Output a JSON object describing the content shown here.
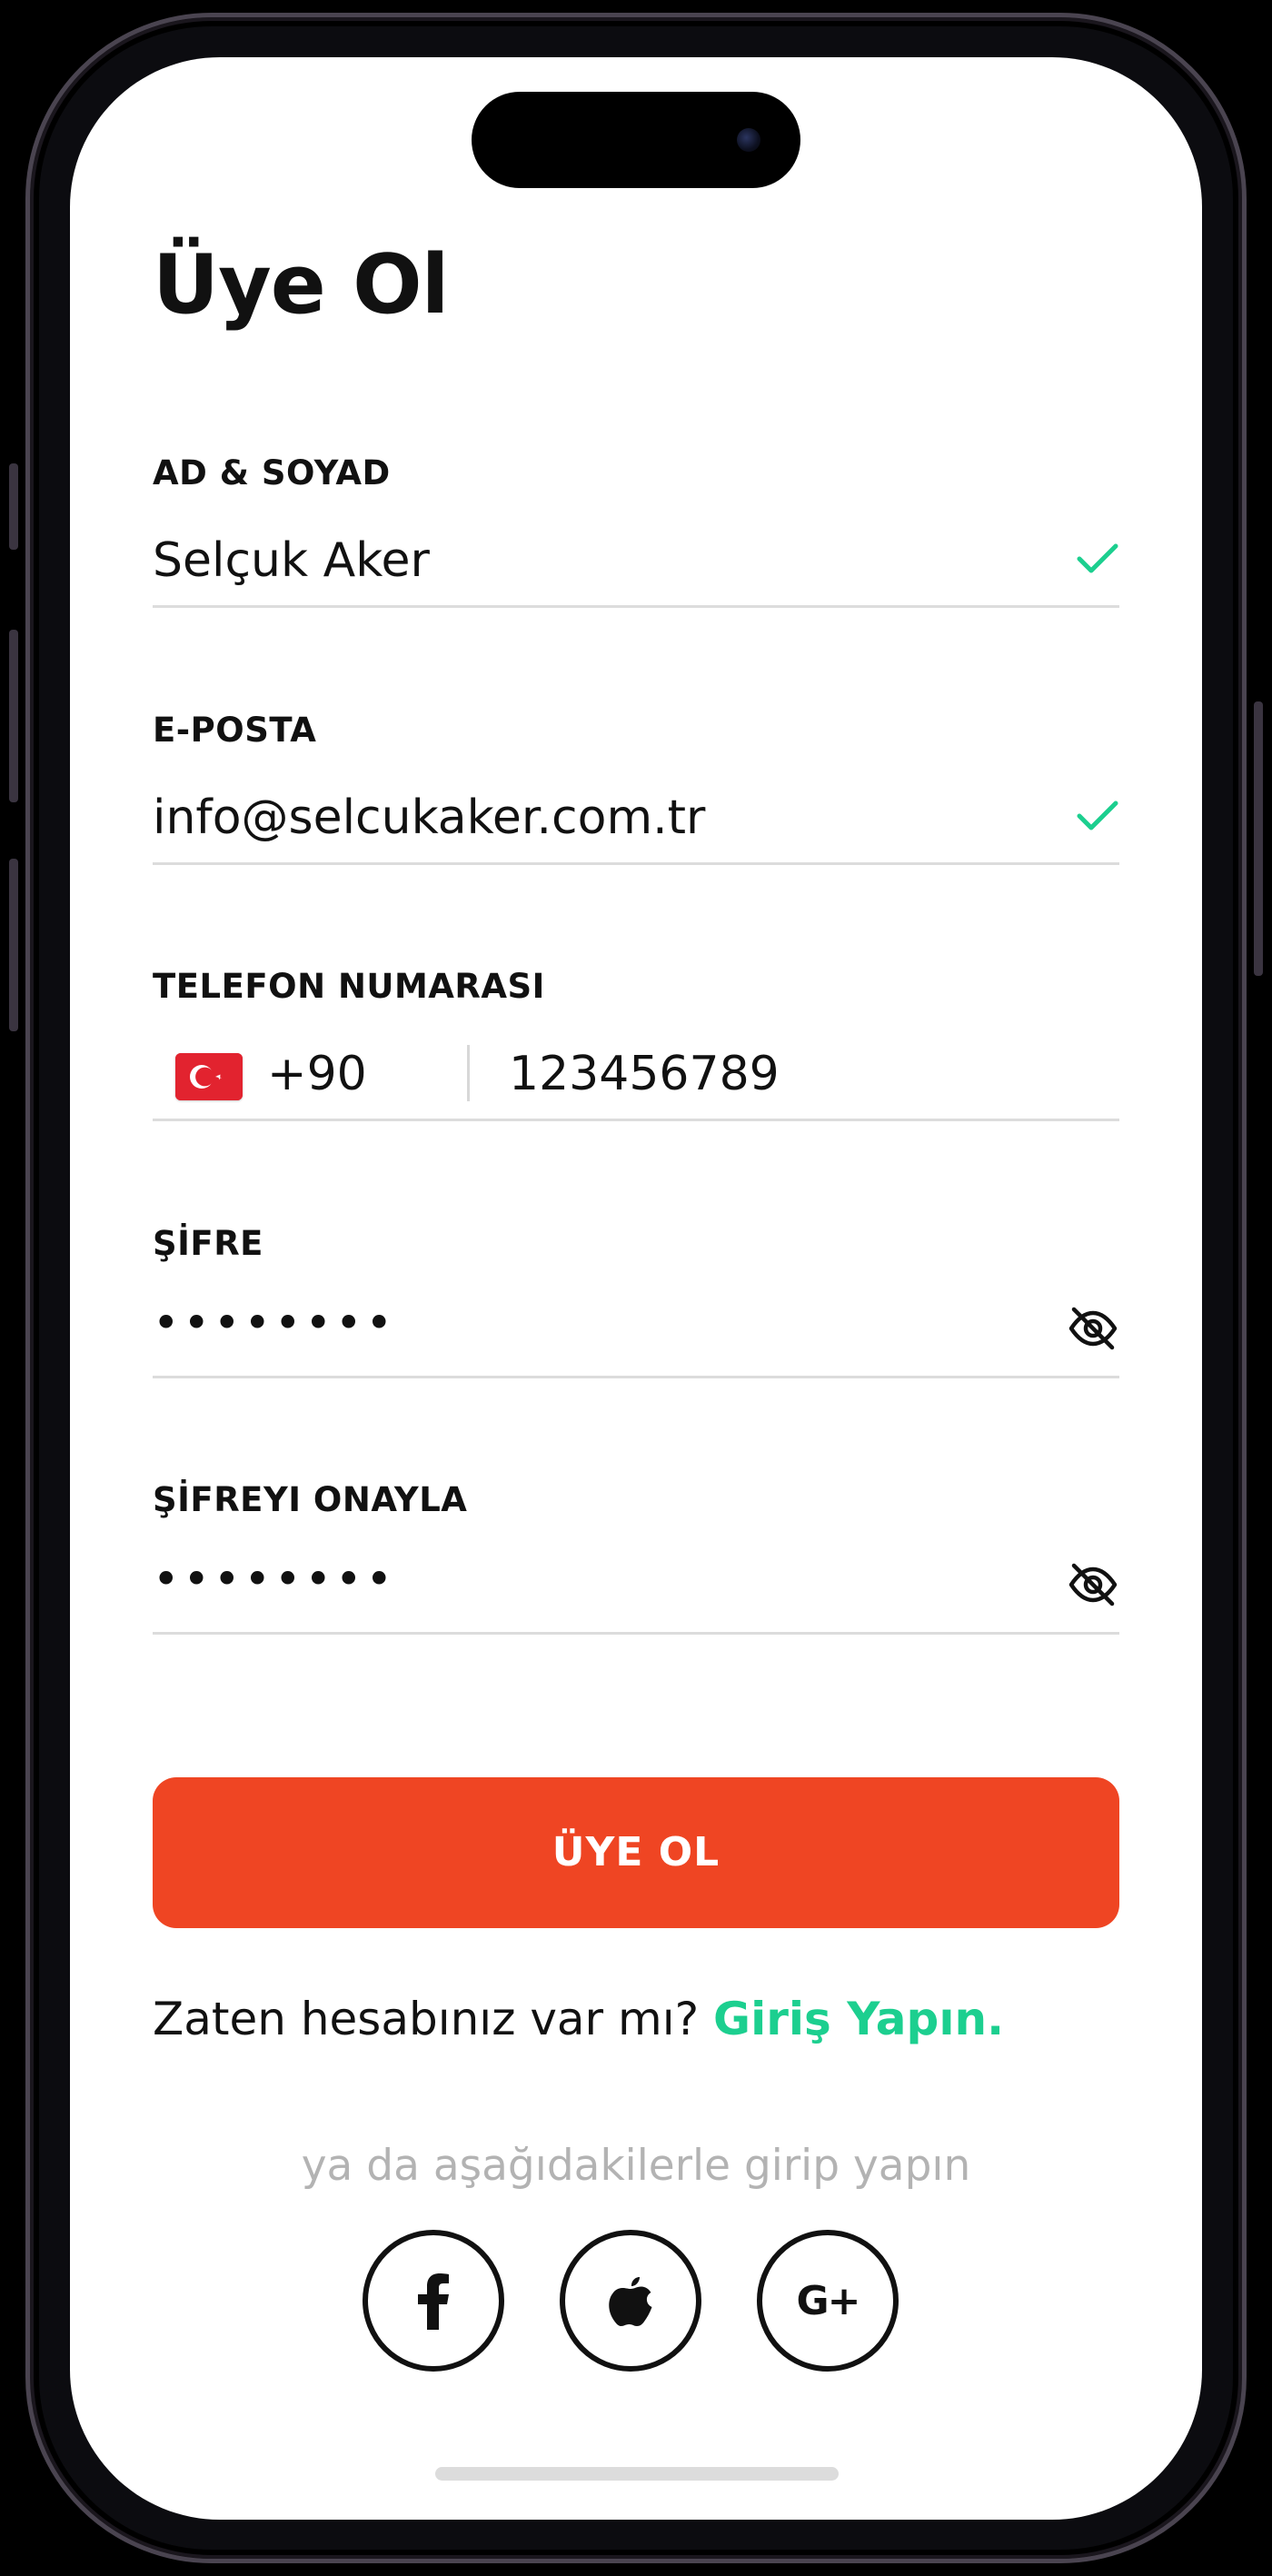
{
  "page": {
    "title": "Üye Ol"
  },
  "form": {
    "name": {
      "label": "AD & SOYAD",
      "value": "Selçuk Aker",
      "valid": true
    },
    "email": {
      "label": "E-POSTA",
      "value": "info@selcukaker.com.tr",
      "valid": true
    },
    "phone": {
      "label": "TELEFON NUMARASI",
      "country_flag": "turkey-flag",
      "dial_code": "+90",
      "number": "123456789"
    },
    "password": {
      "label": "ŞİFRE",
      "masked_value": "••••••••",
      "visibility_icon": "eye-off-icon"
    },
    "password_confirm": {
      "label": "ŞİFREYI ONAYLA",
      "masked_value": "••••••••",
      "visibility_icon": "eye-off-icon"
    },
    "submit_label": "ÜYE OL"
  },
  "login": {
    "prompt": "Zaten hesabınız var mı? ",
    "link": "Giriş Yapın."
  },
  "social": {
    "caption": "ya da aşağıdakilerle girip yapın",
    "buttons": [
      {
        "name": "facebook",
        "icon": "facebook-icon"
      },
      {
        "name": "apple",
        "icon": "apple-icon"
      },
      {
        "name": "google-plus",
        "icon": "google-plus-icon",
        "glyph": "G+"
      }
    ]
  },
  "colors": {
    "accent": "#ef4523",
    "success": "#1ccf8f",
    "text": "#111111",
    "muted": "#b3b3b3",
    "divider": "#dcdcdc"
  }
}
